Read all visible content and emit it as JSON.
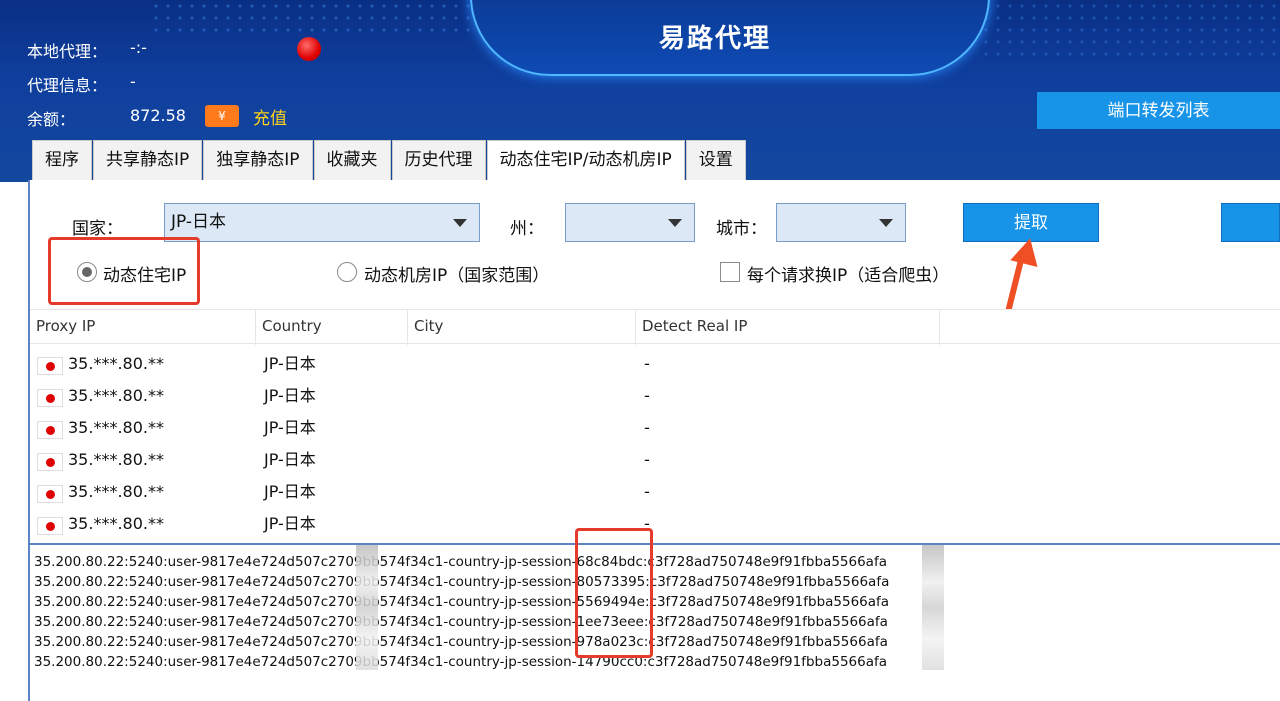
{
  "header": {
    "app_title": "易路代理",
    "local_proxy_label": "本地代理：",
    "local_proxy_value": "-:-",
    "proxy_info_label": "代理信息：",
    "proxy_info_value": "-",
    "balance_label": "余额：",
    "balance_value": "872.58",
    "recharge_icon": "¥",
    "recharge_label": "充值",
    "port_forward_label": "端口转发列表"
  },
  "tabs": [
    {
      "label": "程序"
    },
    {
      "label": "共享静态IP"
    },
    {
      "label": "独享静态IP"
    },
    {
      "label": "收藏夹"
    },
    {
      "label": "历史代理"
    },
    {
      "label": "动态住宅IP/动态机房IP",
      "active": true
    },
    {
      "label": "设置"
    }
  ],
  "form": {
    "country_label": "国家：",
    "country_value": "JP-日本",
    "state_label": "州：",
    "state_value": "",
    "city_label": "城市：",
    "city_value": "",
    "extract_label": "提取",
    "radio_residential": "动态住宅IP",
    "radio_datacenter": "动态机房IP（国家范围）",
    "checkbox_rotate": "每个请求换IP（适合爬虫）"
  },
  "table": {
    "columns": [
      "Proxy IP",
      "Country",
      "City",
      "Detect Real IP"
    ],
    "rows": [
      {
        "ip": "35.***.80.**",
        "country": "JP-日本",
        "city": "",
        "detect": "-"
      },
      {
        "ip": "35.***.80.**",
        "country": "JP-日本",
        "city": "",
        "detect": "-"
      },
      {
        "ip": "35.***.80.**",
        "country": "JP-日本",
        "city": "",
        "detect": "-"
      },
      {
        "ip": "35.***.80.**",
        "country": "JP-日本",
        "city": "",
        "detect": "-"
      },
      {
        "ip": "35.***.80.**",
        "country": "JP-日本",
        "city": "",
        "detect": "-"
      },
      {
        "ip": "35.***.80.**",
        "country": "JP-日本",
        "city": "",
        "detect": "-"
      }
    ]
  },
  "output": {
    "lines": [
      "35.200.80.22:5240:user-9817e4e724d507c2709bb574f34c1-country-jp-session-68c84bdc:c3f728ad750748e9f91fbba5566afa",
      "35.200.80.22:5240:user-9817e4e724d507c2709bb574f34c1-country-jp-session-80573395:c3f728ad750748e9f91fbba5566afa",
      "35.200.80.22:5240:user-9817e4e724d507c2709bb574f34c1-country-jp-session-5569494e:c3f728ad750748e9f91fbba5566afa",
      "35.200.80.22:5240:user-9817e4e724d507c2709bb574f34c1-country-jp-session-1ee73eee:c3f728ad750748e9f91fbba5566afa",
      "35.200.80.22:5240:user-9817e4e724d507c2709bb574f34c1-country-jp-session-978a023c:c3f728ad750748e9f91fbba5566afa",
      "35.200.80.22:5240:user-9817e4e724d507c2709bb574f34c1-country-jp-session-14790cc0:c3f728ad750748e9f91fbba5566afa"
    ]
  },
  "colors": {
    "header_bg": "#0f3f9e",
    "accent_blue": "#1794e8",
    "highlight_red": "#e63a2a",
    "recharge_yellow": "#ffd31a"
  }
}
